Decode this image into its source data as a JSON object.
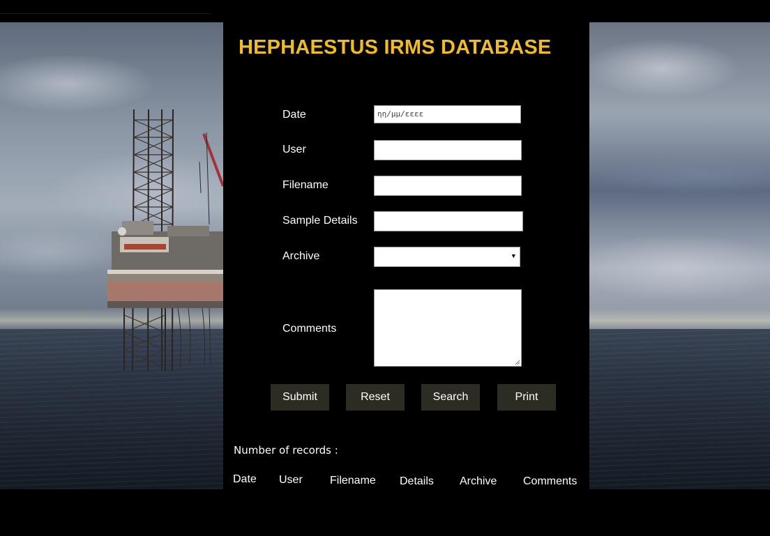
{
  "app": {
    "title": "HEPHAESTUS IRMS DATABASE",
    "title_color": "#f1bc23"
  },
  "form": {
    "date": {
      "label": "Date",
      "placeholder": "ηη/μμ/εεεε",
      "value": ""
    },
    "user": {
      "label": "User",
      "value": ""
    },
    "filename": {
      "label": "Filename",
      "value": ""
    },
    "sample_details": {
      "label": "Sample Details",
      "value": ""
    },
    "archive": {
      "label": "Archive",
      "selected": "",
      "caret": "▼"
    },
    "comments": {
      "label": "Comments",
      "value": ""
    }
  },
  "buttons": {
    "submit": "Submit",
    "reset": "Reset",
    "search": "Search",
    "print": "Print",
    "color": "#2c2c22"
  },
  "results": {
    "count_label": "Number of records :",
    "columns": [
      "Date",
      "User",
      "Filename",
      "Details",
      "Archive",
      "Comments"
    ]
  },
  "background": {
    "panel_color": "#000000",
    "scene": "offshore-oil-rig-at-sea"
  }
}
